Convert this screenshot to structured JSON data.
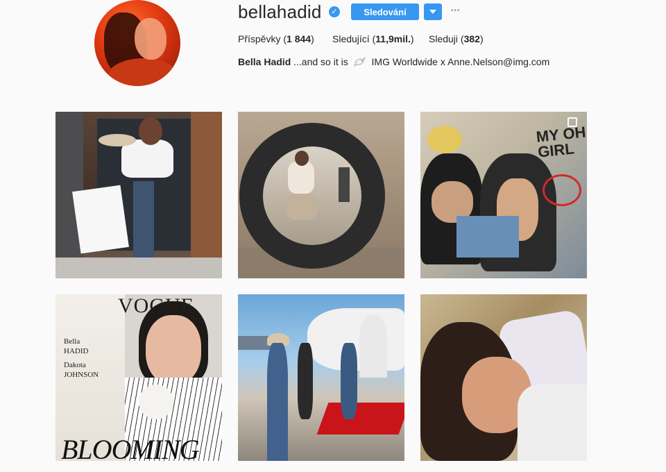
{
  "profile": {
    "username": "bellahadid",
    "verified_mark": "✓",
    "follow_label": "Sledování",
    "more_label": "•••",
    "stats": {
      "posts_label": "Příspěvky",
      "posts_count": "1 844",
      "followers_label": "Sledující",
      "followers_count": "11,9mil.",
      "following_label": "Sleduji",
      "following_count": "382"
    },
    "bio": {
      "full_name": "Bella Hadid",
      "text_before": "...and so it is",
      "text_after": "IMG Worldwide x Anne.Nelson@img.com"
    }
  },
  "posts": [
    {
      "label": "Post 1"
    },
    {
      "label": "Post 2"
    },
    {
      "label": "Post 3",
      "multi": true,
      "graffiti": "MY OH GIRL"
    },
    {
      "label": "Post 4",
      "cover_title": "VOGUE",
      "cover_side": [
        "Bella",
        "HADID",
        "Dakota",
        "JOHNSON"
      ],
      "cover_bottom": "BLOOMING"
    },
    {
      "label": "Post 5"
    },
    {
      "label": "Post 6"
    }
  ],
  "colors": {
    "accent": "#3897f0",
    "background": "#fafafa",
    "text": "#262626"
  },
  "icons": {
    "verified": "verified-badge-icon",
    "dropdown": "chevron-down-icon",
    "more": "more-options-icon",
    "dove": "dove-emoji-icon",
    "multi": "multiple-photos-icon"
  }
}
